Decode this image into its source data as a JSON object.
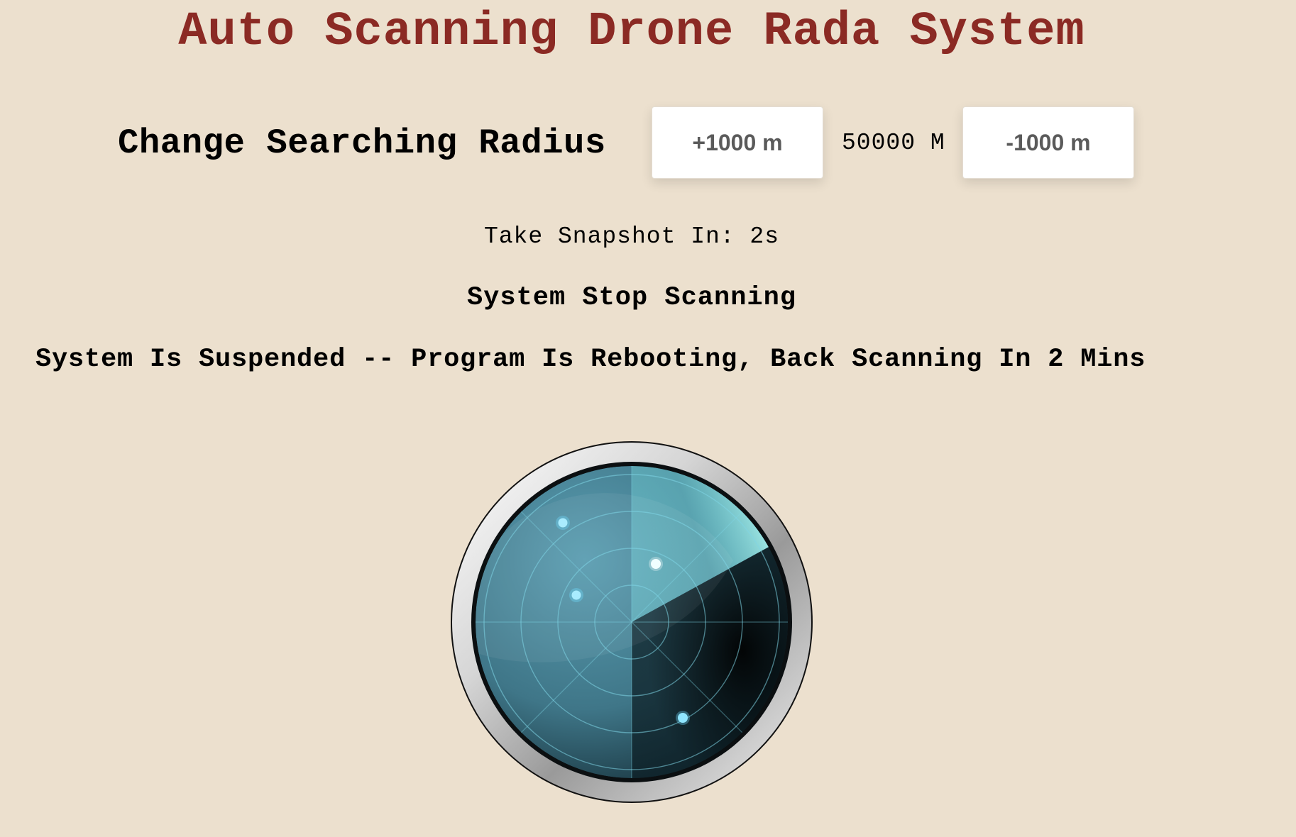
{
  "header": {
    "title": "Auto Scanning Drone Rada System"
  },
  "radius_control": {
    "label": "Change Searching Radius",
    "increase_label": "+1000 m",
    "value_text": "50000 M",
    "decrease_label": "-1000 m"
  },
  "status": {
    "snapshot_text": "Take Snapshot In: 2s",
    "scanning_state": "System Stop Scanning",
    "suspend_message": "System Is Suspended -- Program Is Rebooting, Back Scanning In 2 Mins"
  },
  "radar": {
    "icon": "radar-icon",
    "colors": {
      "screen": "#4f8fa3",
      "sweep": "#9ff5f3",
      "blip": "#8fe6ff",
      "bezel": "#c8c8c8"
    },
    "sweep_direction": "upper-right",
    "blip_count": 4
  },
  "colors": {
    "background": "#ece0ce",
    "title": "#8b2a24",
    "button_bg": "#ffffff",
    "button_text": "#5a5a5a"
  }
}
